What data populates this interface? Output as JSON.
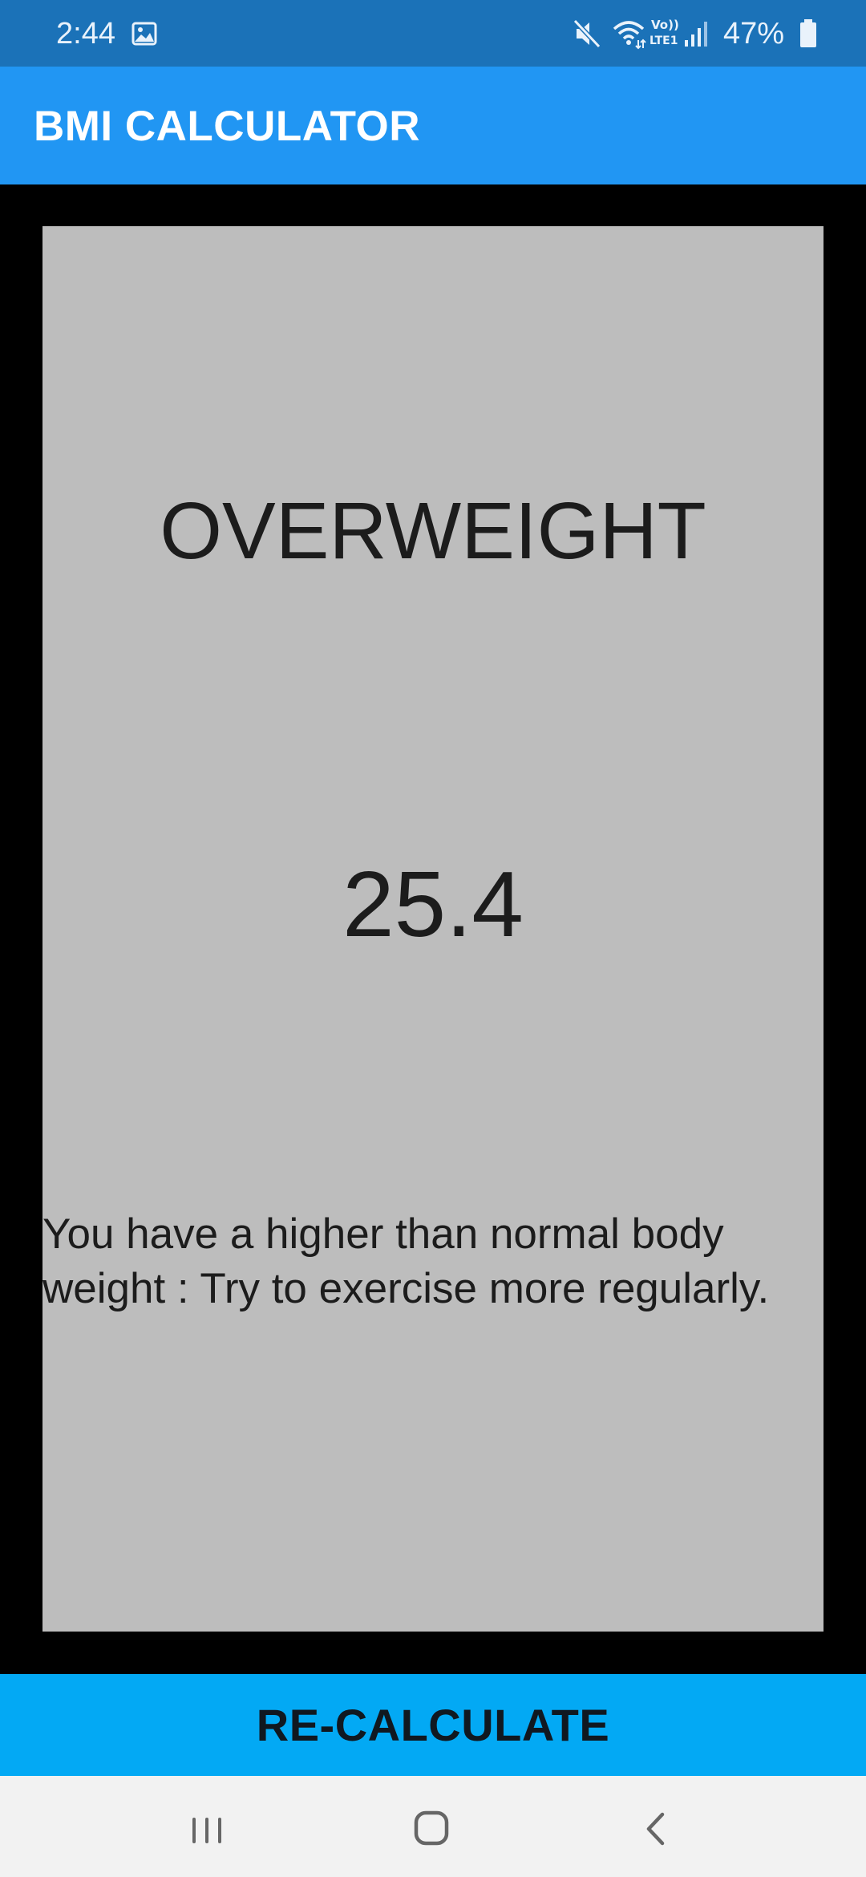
{
  "status_bar": {
    "time": "2:44",
    "battery_percent": "47%",
    "icons": [
      "gallery-icon",
      "mute-icon",
      "wifi-icon",
      "volte-icon",
      "signal-icon",
      "battery-icon"
    ]
  },
  "app_bar": {
    "title": "BMI CALCULATOR"
  },
  "result": {
    "label": "OVERWEIGHT",
    "bmi": "25.4",
    "advice": "You have a higher than normal body weight : Try to exercise more regularly."
  },
  "actions": {
    "recalculate_label": "RE-CALCULATE"
  },
  "nav": {
    "icons": [
      "recents-icon",
      "home-icon",
      "back-icon"
    ]
  },
  "colors": {
    "status_bar": "#1b72b8",
    "app_bar": "#2196f3",
    "card": "#bdbdbd",
    "button": "#03a9f4",
    "background": "#000000"
  }
}
